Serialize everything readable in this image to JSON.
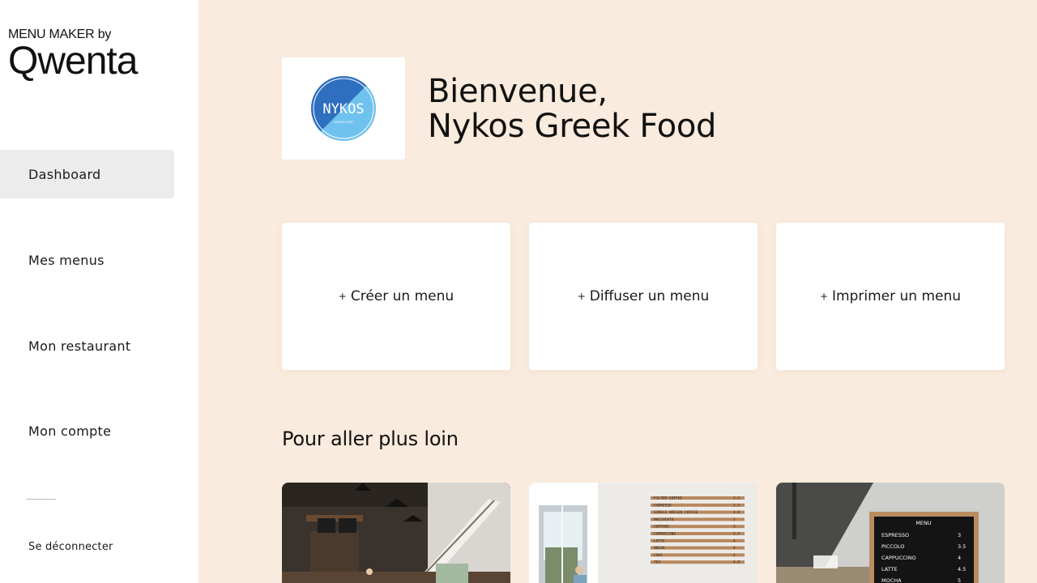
{
  "brand": {
    "top": "MENU MAKER by",
    "name": "Qwenta"
  },
  "nav": {
    "items": [
      {
        "label": "Dashboard",
        "active": true
      },
      {
        "label": "Mes menus",
        "active": false
      },
      {
        "label": "Mon restaurant",
        "active": false
      },
      {
        "label": "Mon compte",
        "active": false
      }
    ],
    "logout": "Se déconnecter"
  },
  "restaurant": {
    "logo_text": "NYKOS",
    "logo_subtext": "GREEK FOOD"
  },
  "welcome": {
    "line1": "Bienvenue,",
    "line2": "Nykos Greek Food"
  },
  "actions": [
    {
      "label": "Créer un menu"
    },
    {
      "label": "Diffuser un menu"
    },
    {
      "label": "Imprimer un menu"
    }
  ],
  "section": {
    "title": "Pour aller plus loin"
  },
  "cards": {
    "menu_board": {
      "title": "MENU",
      "items": [
        {
          "name": "ESPRESSO",
          "price": "3"
        },
        {
          "name": "PICCOLO",
          "price": "3.5"
        },
        {
          "name": "CAPPUCCINO",
          "price": "4"
        },
        {
          "name": "LATTE",
          "price": "4.5"
        },
        {
          "name": "MOCHA",
          "price": "5"
        }
      ]
    },
    "wall_menu": [
      {
        "name": "FILTER COFFEE",
        "price": "2.5"
      },
      {
        "name": "ESPRESSO",
        "price": "2.5"
      },
      {
        "name": "SINGLE ORIGIN COFFEE",
        "price": "4.0"
      },
      {
        "name": "MACCHIATO",
        "price": "3"
      },
      {
        "name": "CORTADO",
        "price": "3"
      },
      {
        "name": "CAPPUCCINO",
        "price": "3.5"
      },
      {
        "name": "LATTE",
        "price": "4"
      },
      {
        "name": "MOCHA",
        "price": "4"
      },
      {
        "name": "CHAI",
        "price": "4"
      },
      {
        "name": "TEA",
        "price": "4.0"
      }
    ]
  },
  "colors": {
    "background": "#f9ebdd",
    "sidebar": "#ffffff",
    "active_item": "#ececec",
    "logo_blue_dark": "#2f6fc0",
    "logo_blue_light": "#6fc2ee"
  }
}
